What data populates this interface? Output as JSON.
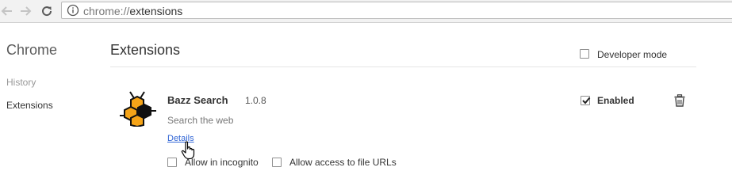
{
  "toolbar": {
    "url_scheme": "chrome://",
    "url_host": "extensions",
    "icons": {
      "back": "arrow-left-icon",
      "forward": "arrow-right-icon",
      "reload": "reload-icon",
      "info": "info-icon"
    }
  },
  "sidebar": {
    "brand": "Chrome",
    "items": [
      {
        "label": "History",
        "selected": false
      },
      {
        "label": "Extensions",
        "selected": true
      }
    ]
  },
  "main": {
    "title": "Extensions",
    "developer_mode": {
      "label": "Developer mode",
      "checked": false
    }
  },
  "extension": {
    "name": "Bazz Search",
    "version": "1.0.8",
    "description": "Search the web",
    "details_link": "Details",
    "enabled": {
      "label": "Enabled",
      "checked": true
    },
    "allow_incognito": {
      "label": "Allow in incognito",
      "checked": false
    },
    "allow_file_urls": {
      "label": "Allow access to file URLs",
      "checked": false
    },
    "icon": "honeycomb-bee-icon"
  },
  "colors": {
    "link": "#3367d6",
    "honeycomb_fill": "#f5a418",
    "toolbar_bg": "#f2f2f2"
  }
}
